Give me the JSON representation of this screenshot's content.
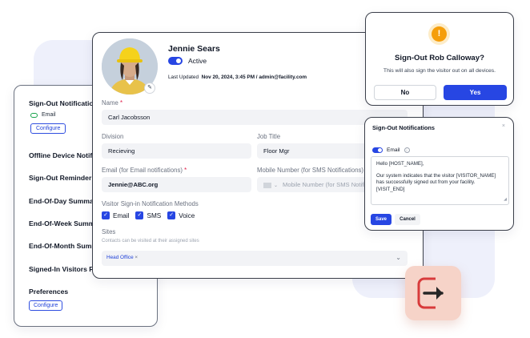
{
  "settings_panel": {
    "sign_out_notifications": "Sign-Out Notifications",
    "email_label": "Email",
    "configure_label": "Configure",
    "rows": [
      "Offline Device Notifications",
      "Sign-Out Reminder",
      "End-Of-Day Summary",
      "End-Of-Week Summary",
      "End-Of-Month Summary",
      "Signed-In Visitors Report"
    ],
    "preferences": "Preferences",
    "preferences_configure": "Configure"
  },
  "profile": {
    "name": "Jennie Sears",
    "status": "Active",
    "last_updated_label": "Last Updated",
    "last_updated_value": "Nov 20, 2024, 3:45 PM / admin@facility.com"
  },
  "form": {
    "name_label": "Name",
    "name_value": "Carl Jacobsson",
    "division_label": "Division",
    "division_value": "Recieving",
    "job_title_label": "Job Title",
    "job_title_value": "Floor Mgr",
    "email_label": "Email (for Email notifications)",
    "email_value": "Jennie@ABC.org",
    "mobile_label": "Mobile Number (for SMS Notifications)",
    "mobile_placeholder": "Mobile Number (for SMS Notifications)",
    "methods_label": "Visitor Sign-in Notification Methods",
    "methods": [
      "Email",
      "SMS",
      "Voice"
    ],
    "sites_label": "Sites",
    "sites_help": "Contacts can be visited at their assigned sites",
    "site_chip": "Head Office"
  },
  "alert": {
    "title": "Sign-Out Rob Calloway?",
    "message": "This will also sign the visitor out on all devices.",
    "no_label": "No",
    "yes_label": "Yes"
  },
  "notification_editor": {
    "title": "Sign-Out Notifications",
    "email_label": "Email",
    "body_line1": "Hello [HOST_NAME],",
    "body_line2": "Our system indicates that the visitor [VISITOR_NAME] has successfully signed out from your facility. [VISIT_END]",
    "save_label": "Save",
    "cancel_label": "Cancel"
  },
  "colors": {
    "primary": "#2746e3",
    "warning": "#f59e0b",
    "tile_bg": "#f6d3c8",
    "tile_accent": "#d83b3b"
  },
  "icons": [
    "warning-icon",
    "close-icon",
    "info-icon",
    "chevron-down-icon",
    "check-icon",
    "edit-icon",
    "sign-out-icon"
  ]
}
